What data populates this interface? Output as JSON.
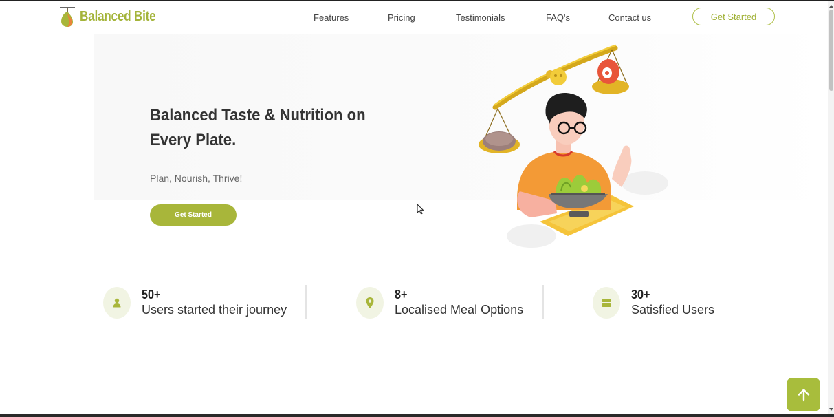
{
  "brand": {
    "name": "Balanced Bite",
    "accent_color": "#a8b63a",
    "logo_icon": "pear-icon"
  },
  "nav": {
    "links": [
      "Features",
      "Pricing",
      "Testimonials",
      "FAQ's",
      "Contact us"
    ],
    "cta_label": "Get Started"
  },
  "hero": {
    "title": "Balanced Taste & Nutrition on Every Plate.",
    "subtitle": "Plan, Nourish, Thrive!",
    "cta_label": "Get Started",
    "illustration": "person-with-salad-and-balance-scale"
  },
  "stats": [
    {
      "icon": "user-icon",
      "value": "50+",
      "label": "Users started their journey"
    },
    {
      "icon": "location-pin-icon",
      "value": "8+",
      "label": "Localised Meal Options"
    },
    {
      "icon": "server-icon",
      "value": "30+",
      "label": "Satisfied Users"
    }
  ],
  "back_to_top": {
    "icon": "arrow-up-icon"
  }
}
